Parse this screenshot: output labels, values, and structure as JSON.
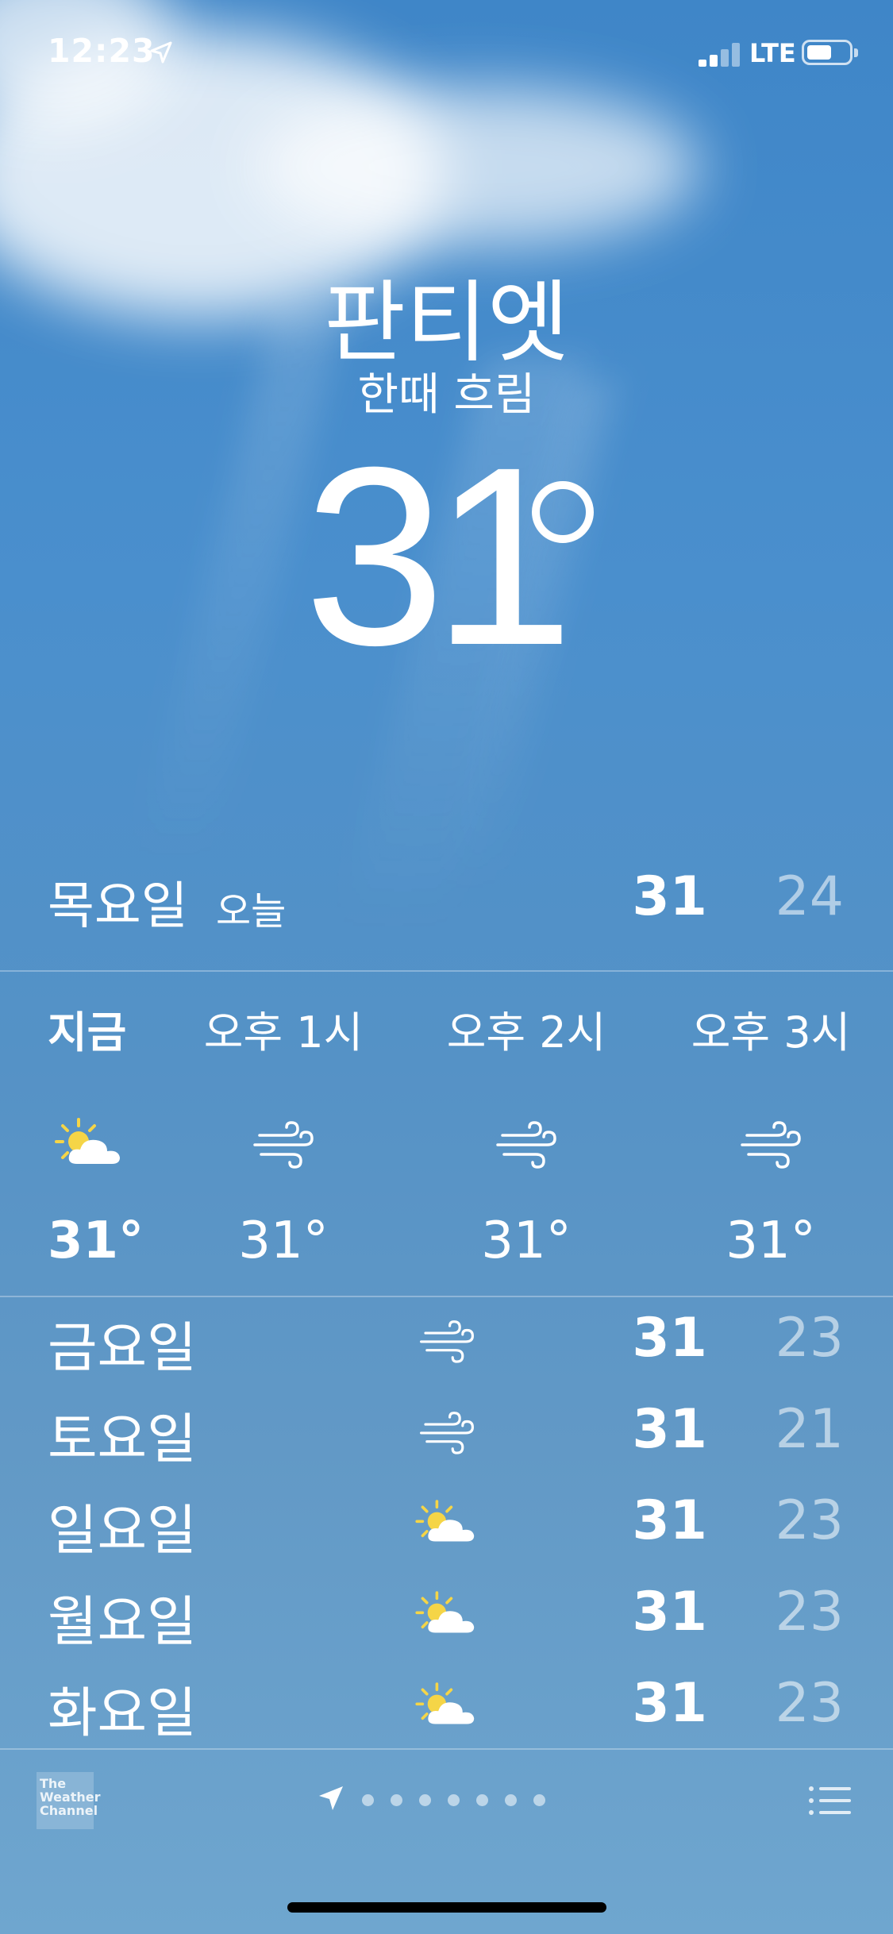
{
  "status_bar": {
    "time": "12:23",
    "network": "LTE"
  },
  "location": {
    "city": "판티엣",
    "condition": "한때 흐림",
    "temperature": "31"
  },
  "today": {
    "day": "목요일",
    "label": "오늘",
    "high": "31",
    "low": "24"
  },
  "hourly": [
    {
      "label": "지금",
      "icon": "partly-cloudy-icon",
      "temp": "31°"
    },
    {
      "label": "오후 1시",
      "icon": "windy-icon",
      "temp": "31°"
    },
    {
      "label": "오후 2시",
      "icon": "windy-icon",
      "temp": "31°"
    },
    {
      "label": "오후 3시",
      "icon": "windy-icon",
      "temp": "31°"
    }
  ],
  "daily": [
    {
      "day": "금요일",
      "icon": "windy-icon",
      "high": "31",
      "low": "23"
    },
    {
      "day": "토요일",
      "icon": "windy-icon",
      "high": "31",
      "low": "21"
    },
    {
      "day": "일요일",
      "icon": "partly-cloudy-icon",
      "high": "31",
      "low": "23"
    },
    {
      "day": "월요일",
      "icon": "partly-cloudy-icon",
      "high": "31",
      "low": "23"
    },
    {
      "day": "화요일",
      "icon": "partly-cloudy-icon",
      "high": "31",
      "low": "23"
    }
  ],
  "footer": {
    "provider_logo": "The Weather Channel",
    "page_count": 8,
    "current_page": 0
  },
  "colors": {
    "sun": "#f5d547",
    "cloud": "#ffffff"
  }
}
